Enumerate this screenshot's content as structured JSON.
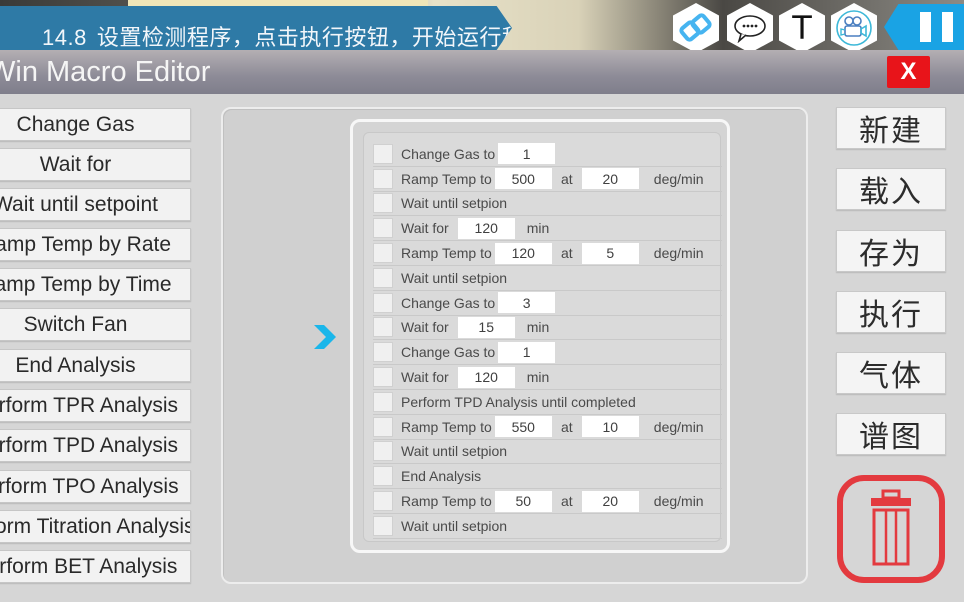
{
  "banner": {
    "step_number": "14.8",
    "instruction": "设置检测程序，点击执行按钮，开始运行程序"
  },
  "toolbar_icons": [
    {
      "name": "link-icon"
    },
    {
      "name": "chat-icon"
    },
    {
      "name": "text-icon",
      "glyph": "T"
    },
    {
      "name": "video-camera-icon"
    }
  ],
  "pause_button": {
    "icon": "pause-icon"
  },
  "window": {
    "title": "Win Macro Editor",
    "close_label": "X"
  },
  "commands": [
    {
      "label": "Change Gas"
    },
    {
      "label": "Wait for"
    },
    {
      "label": "Wait until setpoint"
    },
    {
      "label": "Ramp Temp by Rate"
    },
    {
      "label": "Ramp Temp by Time"
    },
    {
      "label": "Switch Fan"
    },
    {
      "label": "End Analysis"
    },
    {
      "label": "Perform TPR Analysis"
    },
    {
      "label": "Perform TPD Analysis"
    },
    {
      "label": "Perform TPO Analysis"
    },
    {
      "label": "Perform Titration Analysis"
    },
    {
      "label": "Perform BET Analysis"
    }
  ],
  "program_steps": [
    {
      "type": "change_gas",
      "label": "Change Gas to",
      "value1": "1"
    },
    {
      "type": "ramp",
      "label": "Ramp Temp to",
      "value1": "500",
      "at": "at",
      "value2": "20",
      "unit": "deg/min"
    },
    {
      "type": "wait_setpoint",
      "label": "Wait until setpion"
    },
    {
      "type": "wait_for",
      "label": "Wait for",
      "value1": "120",
      "unit": "min"
    },
    {
      "type": "ramp",
      "label": "Ramp Temp to",
      "value1": "120",
      "at": "at",
      "value2": "5",
      "unit": "deg/min"
    },
    {
      "type": "wait_setpoint",
      "label": "Wait until setpion"
    },
    {
      "type": "change_gas",
      "label": "Change Gas to",
      "value1": "3"
    },
    {
      "type": "wait_for",
      "label": "Wait for",
      "value1": "15",
      "unit": "min"
    },
    {
      "type": "change_gas",
      "label": "Change Gas to",
      "value1": "1"
    },
    {
      "type": "wait_for",
      "label": "Wait for",
      "value1": "120",
      "unit": "min"
    },
    {
      "type": "analysis",
      "label": "Perform TPD Analysis until completed"
    },
    {
      "type": "ramp",
      "label": "Ramp Temp to",
      "value1": "550",
      "at": "at",
      "value2": "10",
      "unit": "deg/min"
    },
    {
      "type": "wait_setpoint",
      "label": "Wait until setpion"
    },
    {
      "type": "end",
      "label": "End Analysis"
    },
    {
      "type": "ramp",
      "label": "Ramp Temp to",
      "value1": "50",
      "at": "at",
      "value2": "20",
      "unit": "deg/min"
    },
    {
      "type": "wait_setpoint",
      "label": "Wait until setpion"
    }
  ],
  "actions": {
    "new": "新建",
    "load": "载入",
    "save_as": "存为",
    "execute": "执行",
    "gas": "气体",
    "spectrum": "谱图"
  },
  "colors": {
    "banner": "#2e7aa6",
    "pause": "#1aa3e4",
    "close": "#e8141a",
    "trash": "#e33a3f",
    "arrow": "#1ab6ea"
  }
}
